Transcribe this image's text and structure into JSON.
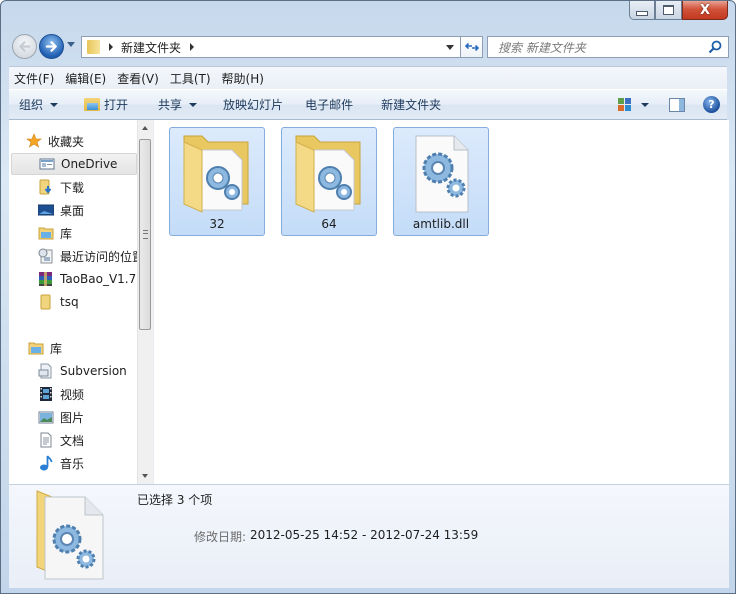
{
  "window": {
    "caption_buttons": {
      "minimize": "minimize",
      "maximize": "maximize",
      "close": "X"
    }
  },
  "navigation": {
    "back_icon": "back-arrow-icon",
    "forward_icon": "forward-arrow-icon",
    "breadcrumb": [
      "新建文件夹"
    ],
    "search_placeholder": "搜索 新建文件夹"
  },
  "menubar": {
    "items": [
      "文件(F)",
      "编辑(E)",
      "查看(V)",
      "工具(T)",
      "帮助(H)"
    ]
  },
  "commandbar": {
    "organize": "组织",
    "open": "打开",
    "share": "共享",
    "slideshow": "放映幻灯片",
    "email": "电子邮件",
    "new_folder": "新建文件夹"
  },
  "navpane": {
    "favorites_header": "收藏夹",
    "favorites": [
      {
        "label": "OneDrive",
        "icon": "onedrive-icon",
        "selected": true
      },
      {
        "label": "下载",
        "icon": "downloads-icon"
      },
      {
        "label": "桌面",
        "icon": "desktop-icon"
      },
      {
        "label": "库",
        "icon": "library-icon"
      },
      {
        "label": "最近访问的位置",
        "icon": "recent-places-icon"
      },
      {
        "label": "TaoBao_V1.7",
        "icon": "winrar-archive-icon"
      },
      {
        "label": "tsq",
        "icon": "folder-icon"
      }
    ],
    "libraries_header": "库",
    "libraries": [
      {
        "label": "Subversion",
        "icon": "subversion-icon"
      },
      {
        "label": "视频",
        "icon": "video-icon"
      },
      {
        "label": "图片",
        "icon": "pictures-icon"
      },
      {
        "label": "文档",
        "icon": "documents-icon"
      },
      {
        "label": "音乐",
        "icon": "music-icon"
      }
    ]
  },
  "files": [
    {
      "name": "32",
      "type": "folder",
      "selected": true
    },
    {
      "name": "64",
      "type": "folder",
      "selected": true
    },
    {
      "name": "amtlib.dll",
      "type": "dll",
      "selected": true
    }
  ],
  "details": {
    "selection": "已选择 3 个项",
    "date_label": "修改日期:",
    "date_range": "2012-05-25 14:52 - 2012-07-24 13:59"
  }
}
